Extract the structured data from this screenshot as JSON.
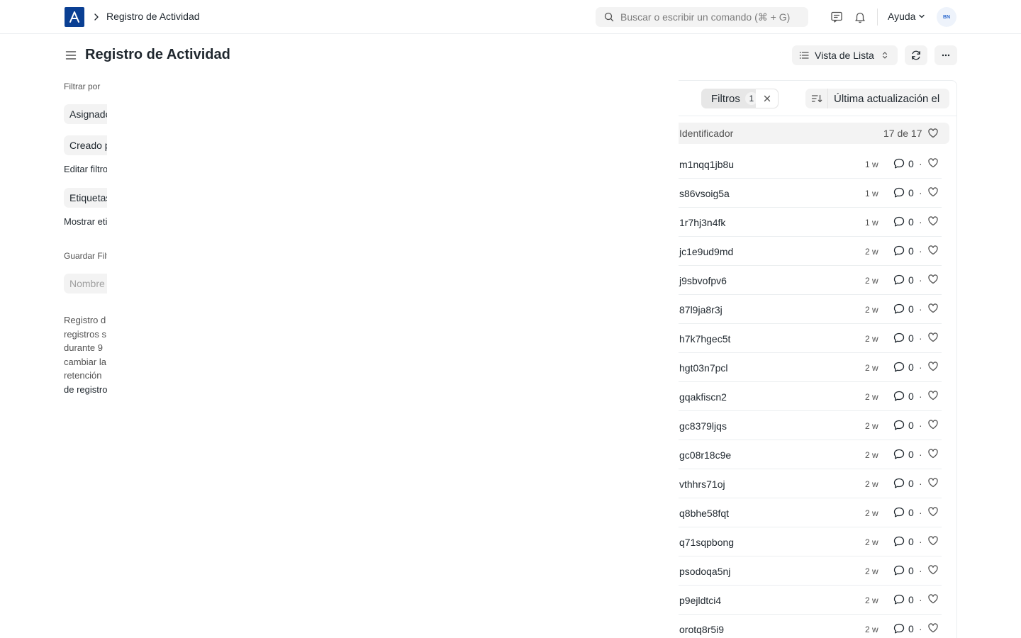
{
  "navbar": {
    "breadcrumb": "Registro de Actividad",
    "search_placeholder": "Buscar o escribir un comando (⌘ + G)",
    "help_label": "Ayuda",
    "avatar_initials": "BN"
  },
  "page": {
    "title": "Registro de Actividad",
    "view_label": "Vista de Lista"
  },
  "sidebar": {
    "filter_by_label": "Filtrar por",
    "assigned_label": "Asignado a",
    "created_label": "Creado por",
    "edit_filters_label": "Editar filtros",
    "tags_label": "Etiquetas",
    "show_tags_label": "Mostrar etiquetas",
    "save_filter_label": "Guardar Filtro",
    "filter_name_placeholder": "Nombre del filtro",
    "description_lines": [
      "Registro d",
      "registros s",
      "durante 9",
      "cambiar la",
      "retención"
    ],
    "description_link": "de registro"
  },
  "list": {
    "filters_label": "Filtros",
    "filters_count": "1",
    "sort_label": "Última actualización el",
    "header_title": "Identificador",
    "header_count": "17 de 17",
    "rows": [
      {
        "name": "m1nqq1jb8u",
        "time": "1 w",
        "comments": "0"
      },
      {
        "name": "s86vsoig5a",
        "time": "1 w",
        "comments": "0"
      },
      {
        "name": "1r7hj3n4fk",
        "time": "1 w",
        "comments": "0"
      },
      {
        "name": "jc1e9ud9md",
        "time": "2 w",
        "comments": "0"
      },
      {
        "name": "j9sbvofpv6",
        "time": "2 w",
        "comments": "0"
      },
      {
        "name": "87l9ja8r3j",
        "time": "2 w",
        "comments": "0"
      },
      {
        "name": "h7k7hgec5t",
        "time": "2 w",
        "comments": "0"
      },
      {
        "name": "hgt03n7pcl",
        "time": "2 w",
        "comments": "0"
      },
      {
        "name": "gqakfiscn2",
        "time": "2 w",
        "comments": "0"
      },
      {
        "name": "gc8379ljqs",
        "time": "2 w",
        "comments": "0"
      },
      {
        "name": "gc08r18c9e",
        "time": "2 w",
        "comments": "0"
      },
      {
        "name": "vthhrs71oj",
        "time": "2 w",
        "comments": "0"
      },
      {
        "name": "q8bhe58fqt",
        "time": "2 w",
        "comments": "0"
      },
      {
        "name": "q71sqpbong",
        "time": "2 w",
        "comments": "0"
      },
      {
        "name": "psodoqa5nj",
        "time": "2 w",
        "comments": "0"
      },
      {
        "name": "p9ejldtci4",
        "time": "2 w",
        "comments": "0"
      },
      {
        "name": "orotq8r5i9",
        "time": "2 w",
        "comments": "0"
      }
    ]
  },
  "colors": {
    "brand": "#0a3f93",
    "button_bg": "#f3f3f3",
    "text": "#1f272e",
    "muted": "#525252",
    "border": "#ebeef0"
  },
  "icons": {
    "logo": "app-logo-icon",
    "search": "search-icon",
    "chat": "chat-icon",
    "notifications": "bell-icon",
    "help_dropdown": "chevron-down-icon",
    "sidebar_toggle": "hamburger-icon",
    "list_view": "list-icon",
    "refresh": "refresh-icon",
    "more": "more-icon",
    "filter": "filter-icon",
    "clear": "close-icon",
    "sort": "sort-icon",
    "comment": "comment-icon",
    "like": "heart-icon"
  }
}
